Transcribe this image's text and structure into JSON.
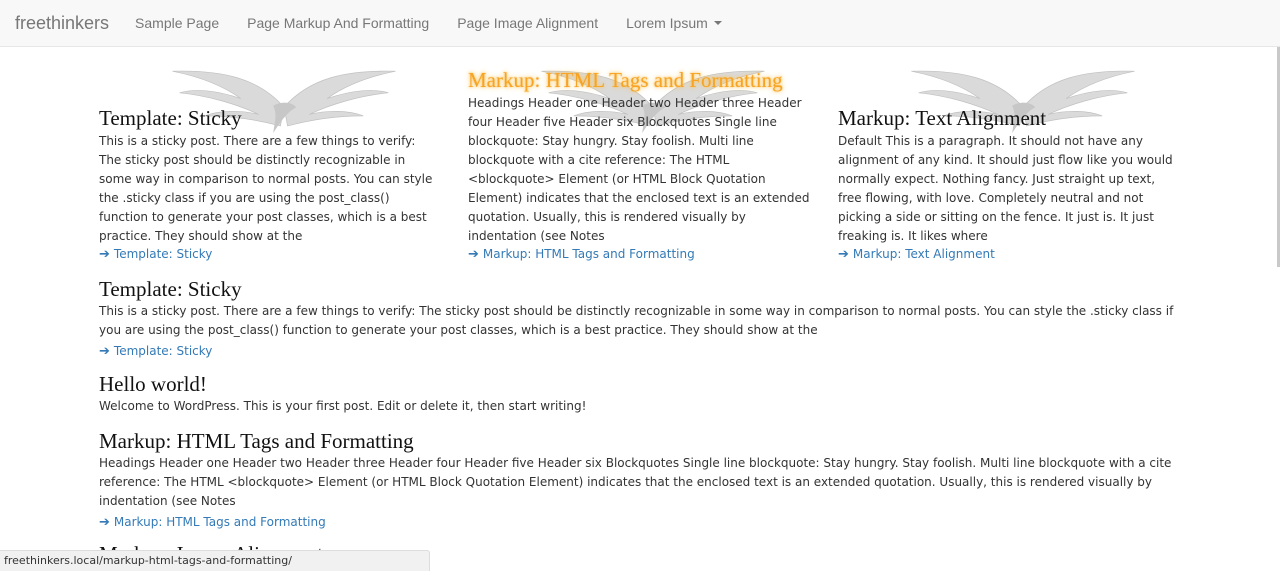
{
  "navbar": {
    "brand": "freethinkers",
    "links": [
      "Sample Page",
      "Page Markup And Formatting",
      "Page Image Alignment",
      "Lorem Ipsum"
    ]
  },
  "featured": [
    {
      "title": "Template: Sticky",
      "excerpt": "This is a sticky post. There are a few things to verify: The sticky post should be distinctly recognizable in some way in comparison to normal posts. You can style the .sticky class if you are using the post_class() function to generate your post classes, which is a best practice. They should show at the",
      "link": "Template: Sticky"
    },
    {
      "title": "Markup: HTML Tags and Formatting",
      "excerpt": "Headings Header one Header two Header three Header four Header five Header six Blockquotes Single line blockquote: Stay hungry. Stay foolish. Multi line blockquote with a cite reference: The HTML <blockquote> Element (or HTML Block Quotation Element) indicates that the enclosed text is an extended quotation. Usually, this is rendered visually by indentation (see Notes",
      "link": "Markup: HTML Tags and Formatting"
    },
    {
      "title": "Markup: Text Alignment",
      "excerpt": "Default This is a paragraph. It should not have any alignment of any kind. It should just flow like you would normally expect. Nothing fancy. Just straight up text, free flowing, with love. Completely neutral and not picking a side or sitting on the fence. It just is. It just freaking is. It likes where",
      "link": "Markup: Text Alignment"
    }
  ],
  "posts": [
    {
      "title": "Template: Sticky",
      "excerpt": "This is a sticky post. There are a few things to verify: The sticky post should be distinctly recognizable in some way in comparison to normal posts. You can style the .sticky class if you are using the post_class() function to generate your post classes, which is a best practice. They should show at the",
      "link": "Template: Sticky"
    },
    {
      "title": "Hello world!",
      "excerpt": "Welcome to WordPress. This is your first post. Edit or delete it, then start writing!",
      "link": ""
    },
    {
      "title": "Markup: HTML Tags and Formatting",
      "excerpt": "Headings Header one Header two Header three Header four Header five Header six Blockquotes Single line blockquote: Stay hungry. Stay foolish. Multi line blockquote with a cite reference: The HTML <blockquote> Element (or HTML Block Quotation Element) indicates that the enclosed text is an extended quotation. Usually, this is rendered visually by indentation (see Notes",
      "link": "Markup: HTML Tags and Formatting"
    },
    {
      "title": "Markup: Image Alignment",
      "excerpt": "",
      "link": ""
    }
  ],
  "status_url": "freethinkers.local/markup-html-tags-and-formatting/",
  "colors": {
    "link": "#337ab7",
    "highlight": "#f7a323"
  },
  "icons": {
    "more_arrow": "arrow-right-icon",
    "dropdown": "caret-down-icon",
    "watermark": "wings-logo"
  }
}
